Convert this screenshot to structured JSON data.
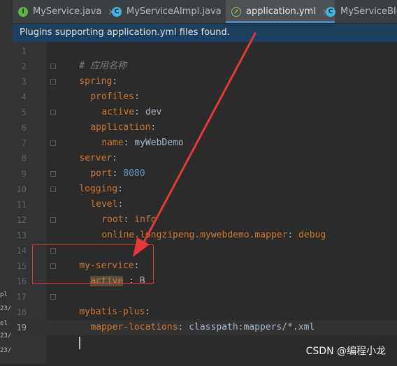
{
  "tabs": [
    {
      "label": "MyService.java",
      "icon": "interface-icon",
      "icon_letter": "I"
    },
    {
      "label": "MyServiceAImpl.java",
      "icon": "class-icon",
      "icon_letter": "C"
    },
    {
      "label": "application.yml",
      "icon": "yml-icon",
      "icon_letter": "",
      "active": true
    },
    {
      "label": "MyServiceBImp",
      "icon": "class-icon",
      "icon_letter": "C"
    }
  ],
  "tab_close": "×",
  "banner": {
    "text": "Plugins supporting application.yml files found."
  },
  "left_strip": [
    "pl",
    "23/",
    "el",
    "23/",
    "23/"
  ],
  "lines": [
    {
      "num": "1"
    },
    {
      "num": "2"
    },
    {
      "num": "3"
    },
    {
      "num": "4"
    },
    {
      "num": "5"
    },
    {
      "num": "6"
    },
    {
      "num": "7"
    },
    {
      "num": "8"
    },
    {
      "num": "9"
    },
    {
      "num": "10"
    },
    {
      "num": "11"
    },
    {
      "num": "12"
    },
    {
      "num": "13"
    },
    {
      "num": "14"
    },
    {
      "num": "15"
    },
    {
      "num": "16"
    },
    {
      "num": "17"
    },
    {
      "num": "18"
    },
    {
      "num": "19"
    }
  ],
  "code": {
    "l1_comment": "# 应用名称",
    "l2_key": "spring",
    "colon": ":",
    "l3_key": "profiles",
    "l4_key": "active",
    "l4_val": "dev",
    "l5_key": "application",
    "l6_key": "name",
    "l6_val": "myWebDemo",
    "l7_key": "server",
    "l8_key": "port",
    "l8_val": "8080",
    "l9_key": "logging",
    "l10_key": "level",
    "l11_key": "root",
    "l11_val": "info",
    "l12_key": "online.longzipeng.mywebdemo.mapper",
    "l12_val": "debug",
    "l14_key": "my-service",
    "l15_key": "active",
    "l15_sep": " : ",
    "l15_val": "B",
    "l17_key": "mybatis-plus",
    "l18_key": "mapper-locations",
    "l18_val": "classpath:mappers/*.xml"
  },
  "watermark": "CSDN @编程小龙",
  "colors": {
    "key": "#cc7832",
    "value": "#a9b7c6",
    "number": "#6897bb",
    "comment": "#808080",
    "annotation": "#e53935"
  }
}
